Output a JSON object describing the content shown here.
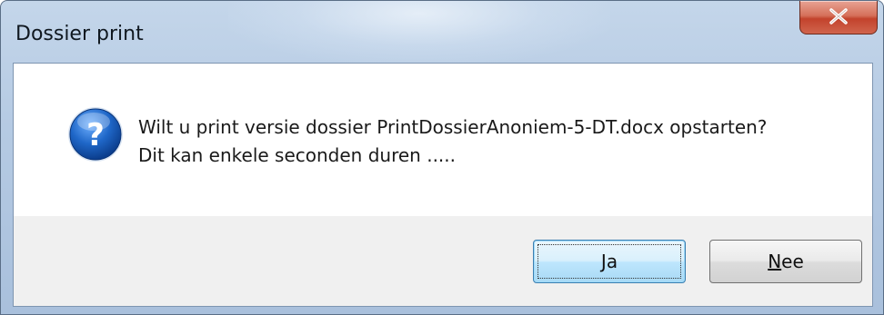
{
  "window": {
    "title": "Dossier print",
    "close_icon": "close-icon"
  },
  "message": {
    "icon": "question-icon",
    "line1": "Wilt u print versie dossier PrintDossierAnoniem-5-DT.docx opstarten?",
    "line2": "Dit kan enkele seconden duren ....."
  },
  "buttons": {
    "ja": {
      "mnemonic": "J",
      "rest": "a"
    },
    "nee": {
      "mnemonic": "N",
      "rest": "ee"
    }
  },
  "colors": {
    "accent": "#1f67c8",
    "close_button": "#c3432c"
  }
}
